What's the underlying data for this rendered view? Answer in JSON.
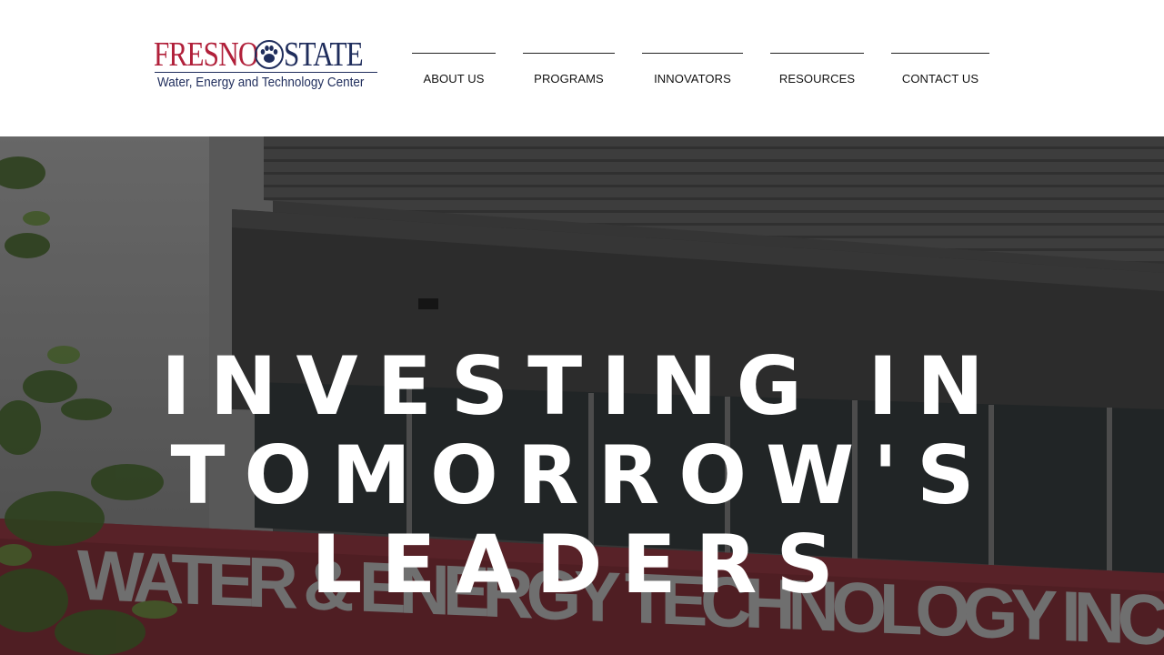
{
  "logo": {
    "fresno": "FRESNO",
    "state": "STATE",
    "subtitle": "Water, Energy and Technology Center"
  },
  "nav": {
    "items": [
      {
        "label": "ABOUT US"
      },
      {
        "label": "PROGRAMS"
      },
      {
        "label": "INNOVATORS"
      },
      {
        "label": "RESOURCES"
      },
      {
        "label": "CONTACT US"
      }
    ]
  },
  "hero": {
    "title_lines": [
      "INVESTING IN",
      "TOMORROW'S",
      "LEADERS"
    ],
    "building_sign": "WATER & ENERGY TECHNOLOGY INC"
  },
  "colors": {
    "brand_red": "#b1203a",
    "brand_navy": "#1f2d5c",
    "hero_text": "#ffffff"
  }
}
